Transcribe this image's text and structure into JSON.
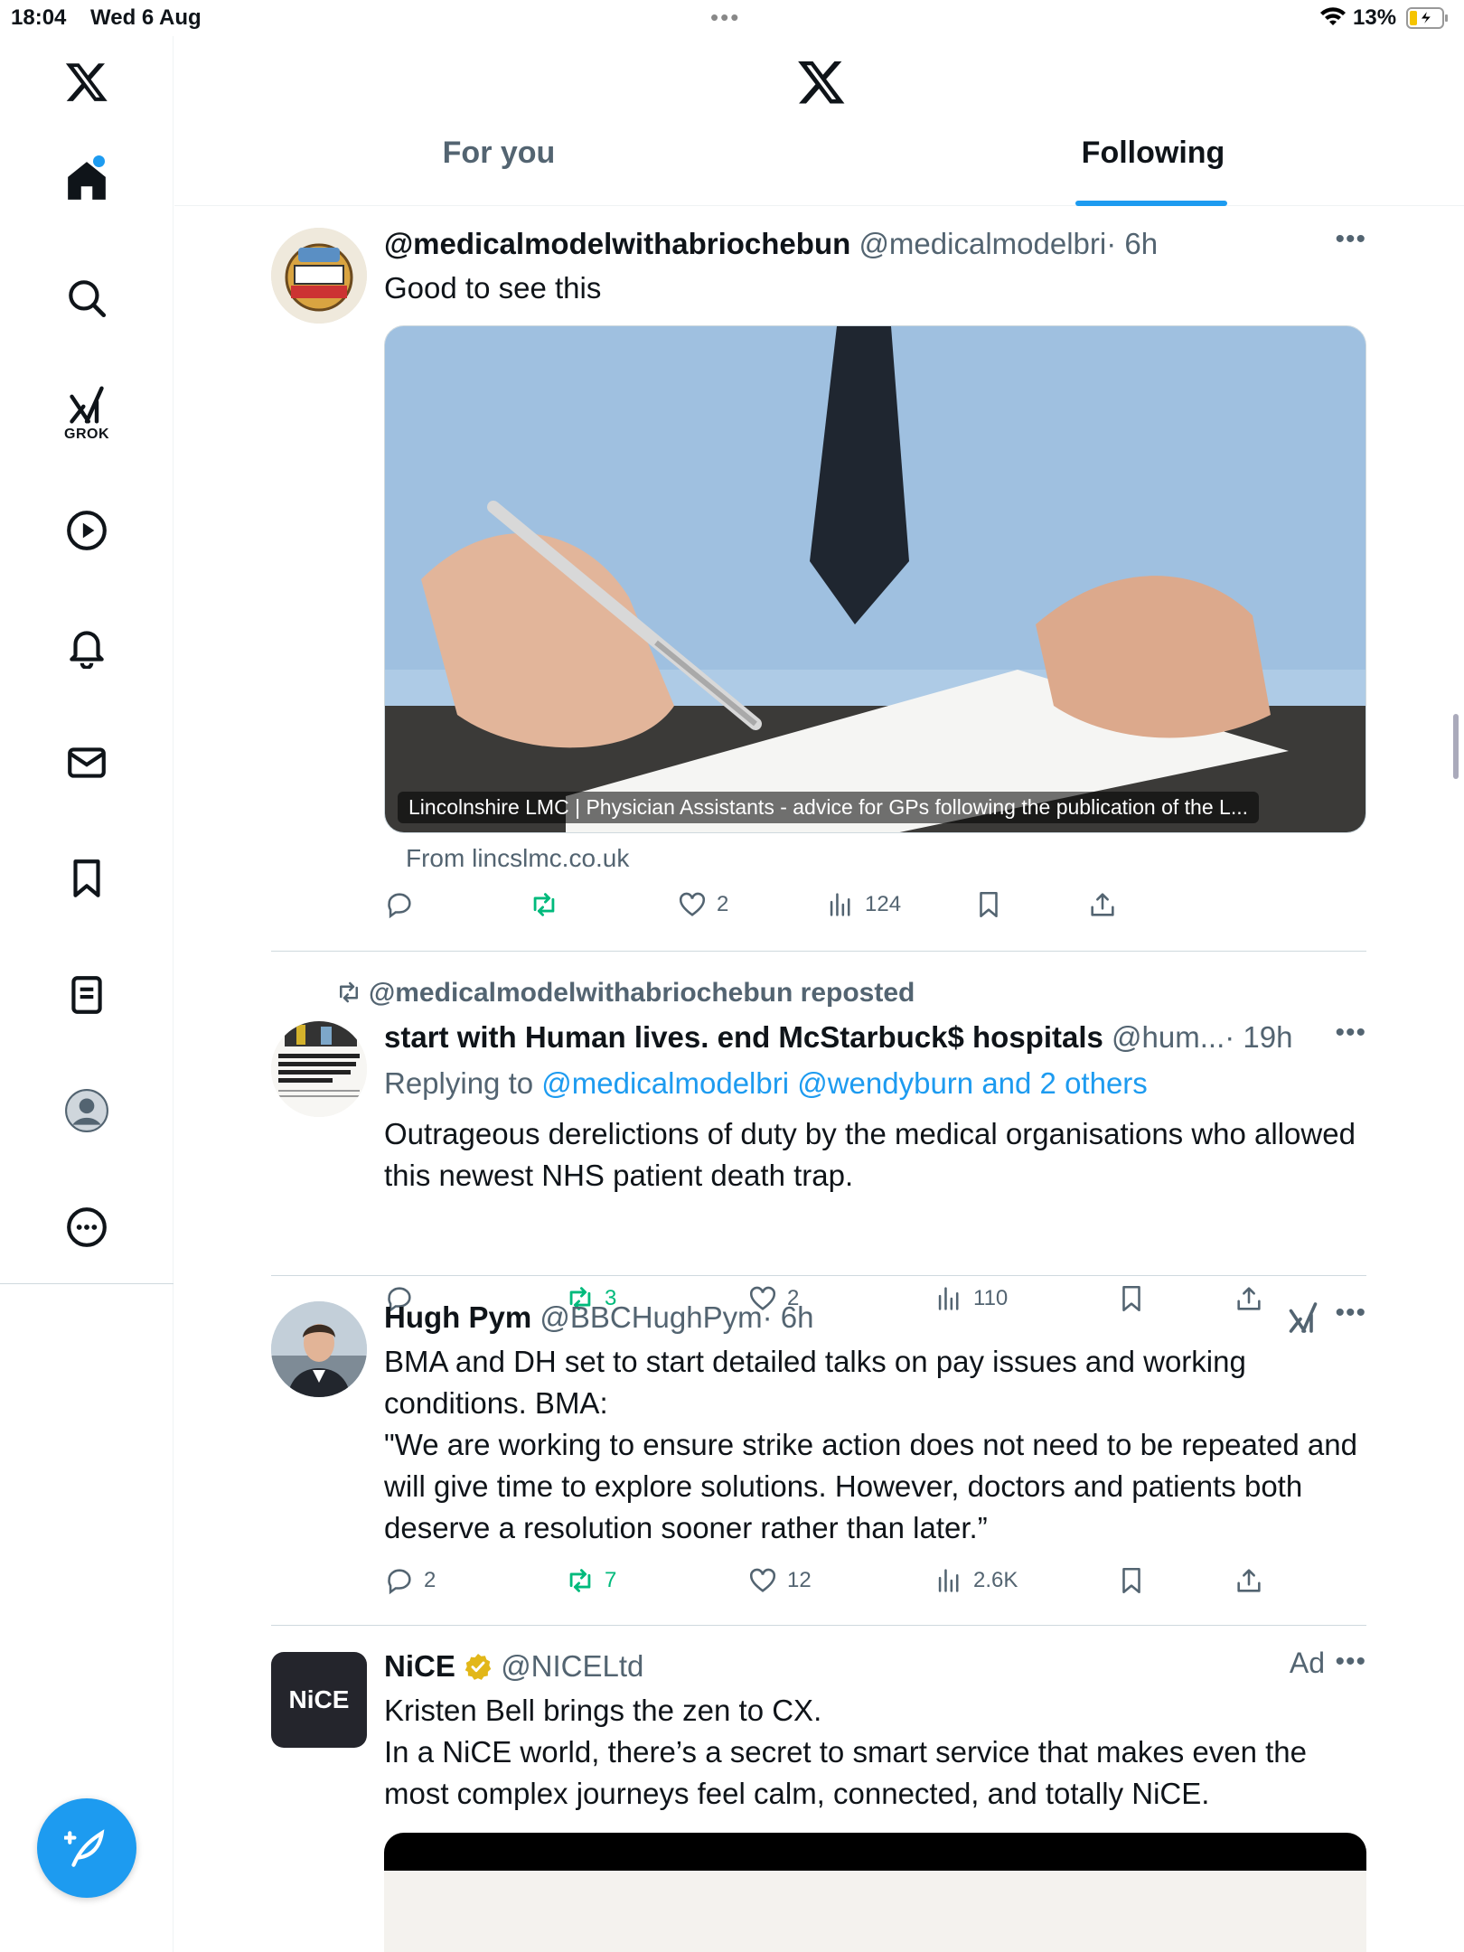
{
  "status_bar": {
    "time": "18:04",
    "date": "Wed 6 Aug",
    "battery_pct": "13%"
  },
  "header": {
    "tabs": [
      {
        "label": "For you"
      },
      {
        "label": "Following"
      }
    ]
  },
  "sidebar": {
    "grok_label": "GROK"
  },
  "posts": [
    {
      "name": "@medicalmodelwithabriochebun",
      "handle": "@medicalmodelbri",
      "time": "· 6h",
      "text": "Good to see this",
      "card_caption": "Lincolnshire LMC | Physician Assistants - advice for GPs following the publication of the L...",
      "card_source": "From lincslmc.co.uk",
      "stats": {
        "replies": "",
        "reposts": "",
        "likes": "2",
        "views": "124"
      }
    },
    {
      "repost_label": "@medicalmodelwithabriochebun reposted",
      "name": "start with Human lives. end McStarbuck$ hospitals",
      "handle": "@hum...",
      "time": "· 19h",
      "reply_prefix": "Replying to",
      "reply_to": "@medicalmodelbri @wendyburn and 2 others",
      "text": "Outrageous derelictions of duty by the medical organisations who allowed this newest NHS patient death trap.",
      "stats": {
        "replies": "",
        "reposts": "3",
        "likes": "2",
        "views": "110"
      }
    },
    {
      "name": "Hugh Pym",
      "handle": "@BBCHughPym",
      "time": "· 6h",
      "text_lines": [
        "BMA and DH set to start detailed talks on pay issues and working conditions. BMA:",
        "\"We are working to ensure strike action does not need to be repeated and will give time to explore solutions. However, doctors and patients both deserve a resolution sooner rather than later.”"
      ],
      "stats": {
        "replies": "2",
        "reposts": "7",
        "likes": "12",
        "views": "2.6K"
      }
    },
    {
      "name": "NiCE",
      "handle": "@NICELtd",
      "ad_label": "Ad",
      "avatar_text": "NiCE",
      "text_lines": [
        "Kristen Bell brings the zen to CX.",
        "In a NiCE world, there’s a secret to smart service that makes even the most complex journeys feel calm, connected, and totally NiCE."
      ]
    }
  ],
  "colors": {
    "accent": "#1d9bf0",
    "repost_green": "#00ba7c",
    "secondary_text": "#536471"
  }
}
